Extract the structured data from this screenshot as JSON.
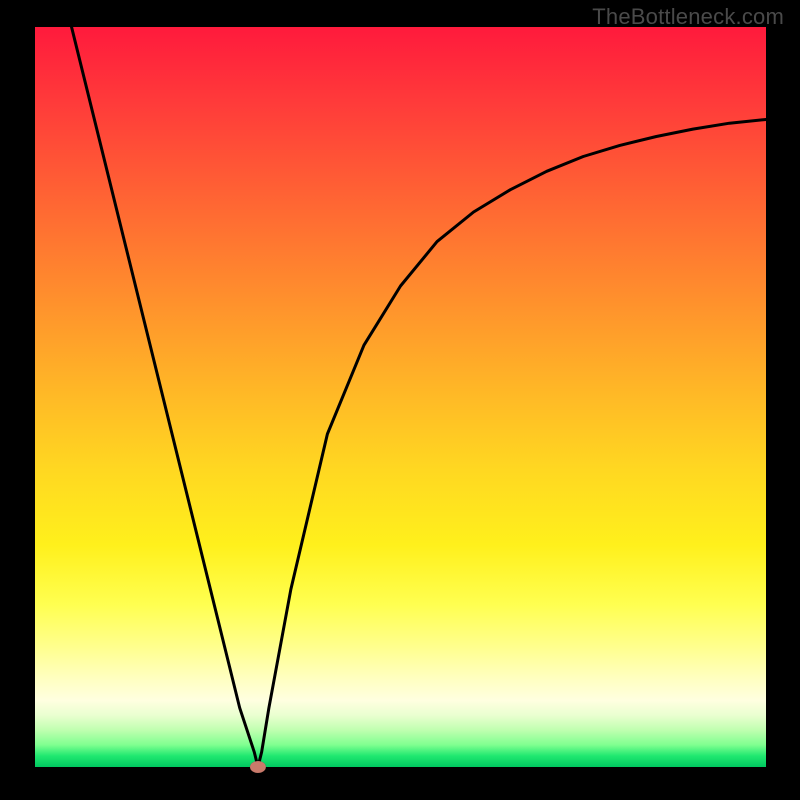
{
  "watermark": "TheBottleneck.com",
  "chart_data": {
    "type": "line",
    "title": "",
    "xlabel": "",
    "ylabel": "",
    "xlim": [
      0,
      100
    ],
    "ylim": [
      0,
      100
    ],
    "grid": false,
    "legend": false,
    "series": [
      {
        "name": "curve",
        "x": [
          5,
          10,
          15,
          20,
          25,
          28,
          30,
          30.5,
          31,
          32,
          35,
          40,
          45,
          50,
          55,
          60,
          65,
          70,
          75,
          80,
          85,
          90,
          95,
          100
        ],
        "y": [
          100,
          80,
          60,
          40,
          20,
          8,
          2,
          0,
          2,
          8,
          24,
          45,
          57,
          65,
          71,
          75,
          78,
          80.5,
          82.5,
          84,
          85.2,
          86.2,
          87,
          87.5
        ]
      }
    ],
    "marker": {
      "x": 30.5,
      "y": 0
    },
    "colors": {
      "curve_stroke": "#000000",
      "marker_fill": "#c97a6b",
      "gradient_top": "#ff1a3c",
      "gradient_bottom": "#00c860",
      "frame": "#000000"
    }
  }
}
